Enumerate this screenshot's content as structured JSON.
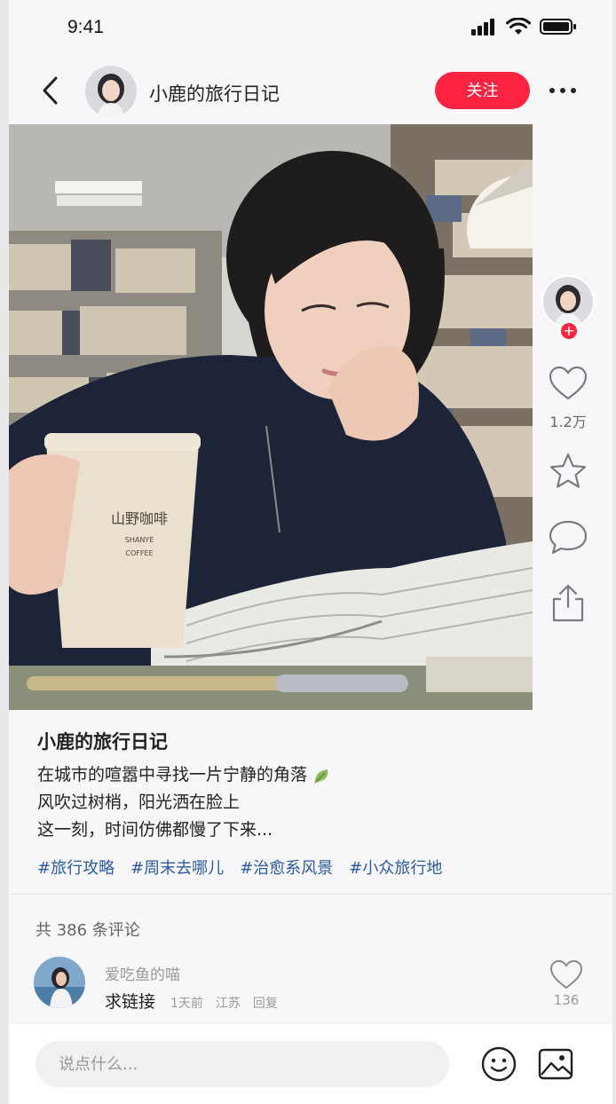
{
  "status": {
    "time": "9:41"
  },
  "header": {
    "author_name": "小鹿的旅行日记",
    "follow_label": "关注"
  },
  "photo": {
    "cup_text": "山野咖啡",
    "cup_sub1": "SHANYE",
    "cup_sub2": "COFFEE"
  },
  "sidebar": {
    "like_count": "1.2万",
    "plus": "+"
  },
  "post": {
    "title": "小鹿的旅行日记",
    "lines": [
      "在城市的喧嚣中寻找一片宁静的角落",
      "风吹过树梢，阳光洒在脸上",
      "这一刻，时间仿佛都慢了下来..."
    ],
    "tags": [
      "#旅行攻略",
      "#周末去哪儿",
      "#治愈系风景",
      "#小众旅行地"
    ]
  },
  "comments": {
    "count_text": "共 386 条评论",
    "items": [
      {
        "user": "爱吃鱼的喵",
        "text": "求链接",
        "time": "1天前",
        "location": "江苏",
        "reply": "回复",
        "likes": "136"
      }
    ]
  },
  "composer": {
    "placeholder": "说点什么..."
  },
  "colors": {
    "accent": "#ff2442",
    "tag": "#2d5a9a"
  }
}
